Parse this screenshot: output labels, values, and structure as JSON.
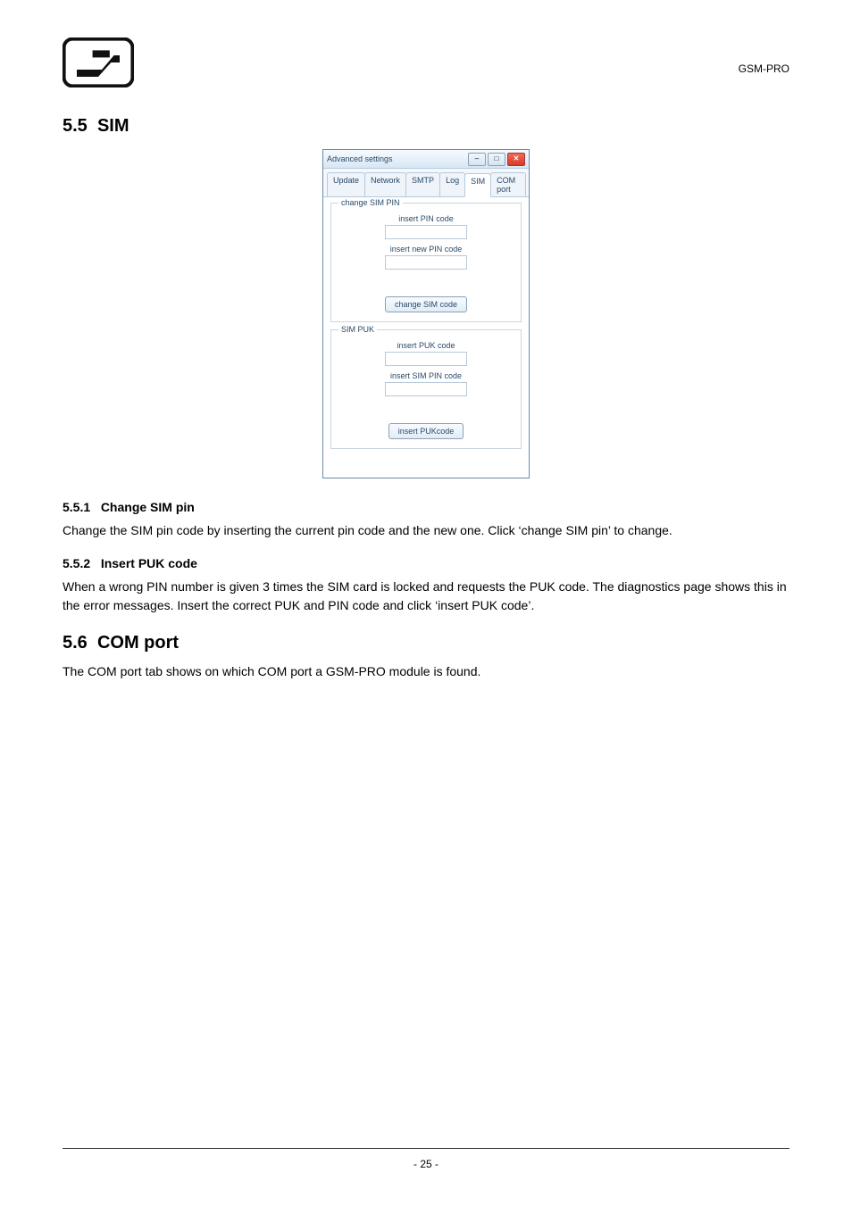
{
  "header": {
    "doc_id": "GSM-PRO"
  },
  "sections": {
    "s55": {
      "num": "5.5",
      "title": "SIM"
    },
    "s551": {
      "num": "5.5.1",
      "title": "Change SIM pin",
      "para": "Change the SIM pin code by inserting the current pin code and the new one. Click ‘change SIM pin’ to change."
    },
    "s552": {
      "num": "5.5.2",
      "title": "Insert PUK code",
      "para": "When a wrong PIN number is given 3 times the SIM card is locked and requests the PUK code. The diagnostics page shows this in the error messages. Insert the correct PUK and PIN code and click ‘insert PUK code’."
    },
    "s56": {
      "num": "5.6",
      "title": "COM port",
      "para": "The COM port tab shows on which COM port a GSM-PRO module is found."
    }
  },
  "dialog": {
    "title": "Advanced settings",
    "tabs": [
      "Update",
      "Network",
      "SMTP",
      "Log",
      "SIM",
      "COM port"
    ],
    "active_tab_index": 4,
    "group1": {
      "legend": "change SIM PIN",
      "label1": "insert PIN code",
      "label2": "insert new PIN code",
      "button": "change SIM code"
    },
    "group2": {
      "legend": "SIM PUK",
      "label1": "insert PUK code",
      "label2": "insert SIM PIN code",
      "button": "insert PUKcode"
    },
    "winbtn_min": "–",
    "winbtn_max": "□",
    "winbtn_close": "✕"
  },
  "footer": {
    "page": "- 25 -"
  }
}
